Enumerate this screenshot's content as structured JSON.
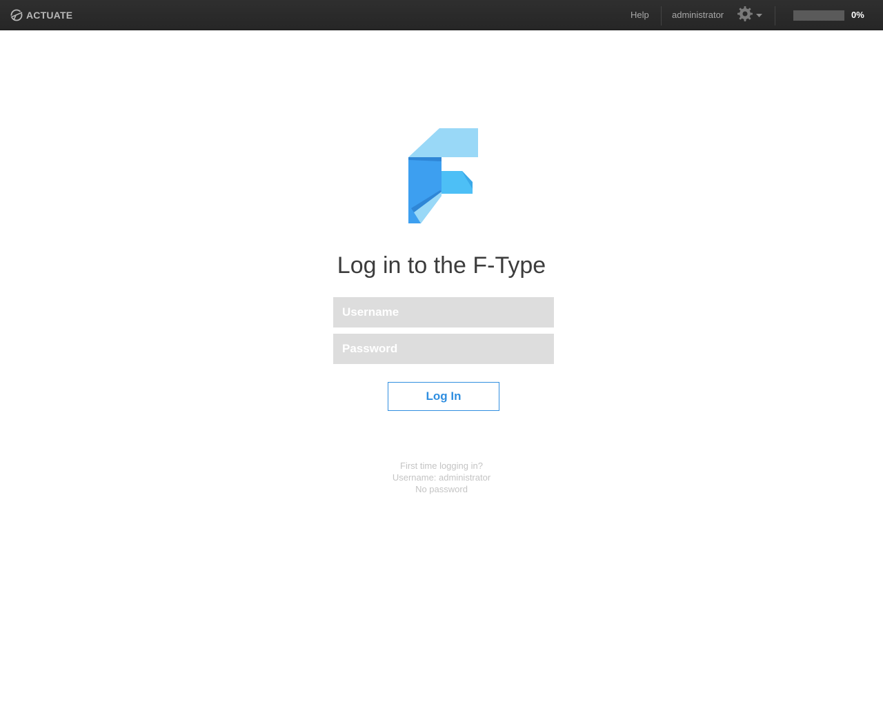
{
  "header": {
    "brand": "ACTUATE",
    "help_label": "Help",
    "user_label": "administrator",
    "settings_icon": "gear-icon",
    "dropdown_icon": "caret-down-icon",
    "progress_value": 0,
    "progress_label": "0%"
  },
  "login": {
    "logo_icon": "f-type-logo",
    "title": "Log in to the F-Type",
    "username_placeholder": "Username",
    "password_placeholder": "Password",
    "submit_label": "Log In"
  },
  "hint": {
    "line1": "First time logging in?",
    "line2": "Username: administrator",
    "line3": "No password"
  },
  "colors": {
    "accent": "#2f8ee0",
    "topbar": "#2a2a2a",
    "field_bg": "#dddddd",
    "logo_light": "#99d8f7",
    "logo_mid": "#4dbff6",
    "logo_dark": "#3d9ff0"
  }
}
